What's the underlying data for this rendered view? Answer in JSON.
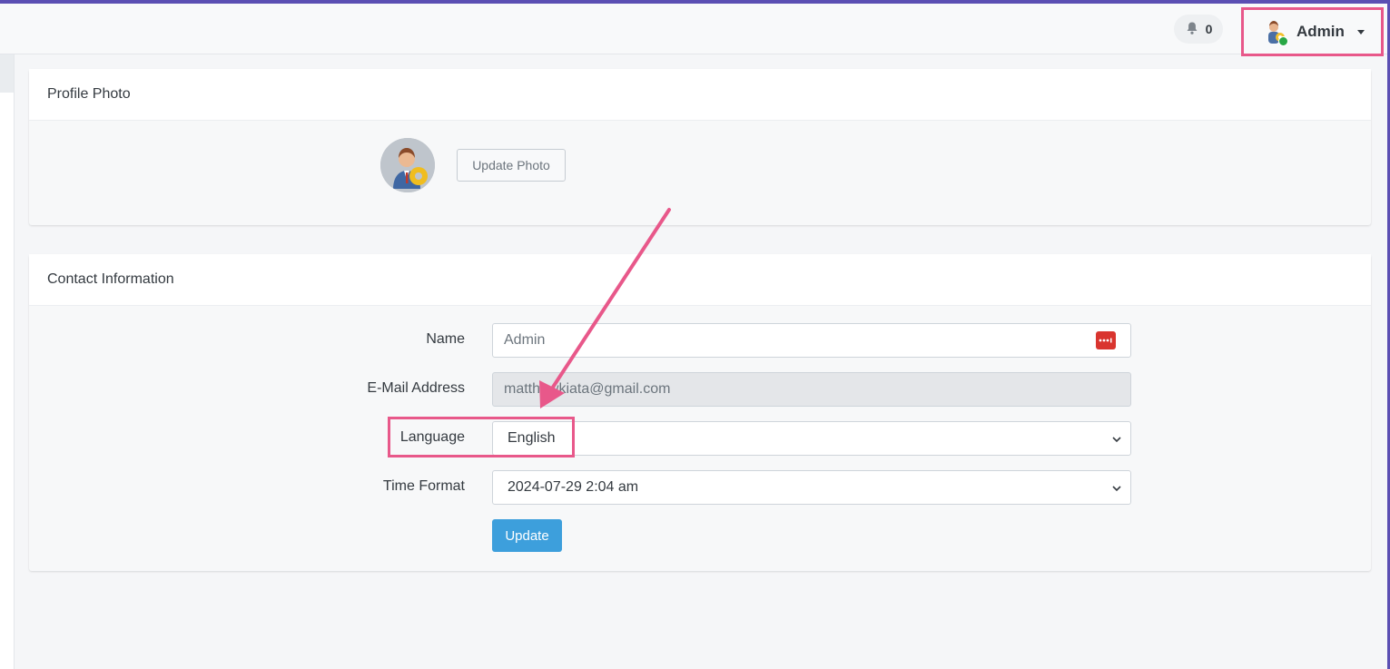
{
  "topbar": {
    "notification_count": "0",
    "user_name": "Admin"
  },
  "profile_photo": {
    "title": "Profile Photo",
    "update_button": "Update Photo"
  },
  "contact": {
    "title": "Contact Information",
    "name_label": "Name",
    "name_value": "Admin",
    "email_label": "E-Mail Address",
    "email_value": "matthewkiata@gmail.com",
    "language_label": "Language",
    "language_value": "English",
    "time_format_label": "Time Format",
    "time_format_value": "2024-07-29 2:04 am",
    "update_button": "Update"
  },
  "colors": {
    "accent": "#3d9fdc",
    "annotation": "#e8588a",
    "status_online": "#28a745",
    "password_manager": "#d9352f"
  },
  "icons": [
    "bell-icon",
    "avatar",
    "chevron-down-icon",
    "password-manager-icon"
  ]
}
